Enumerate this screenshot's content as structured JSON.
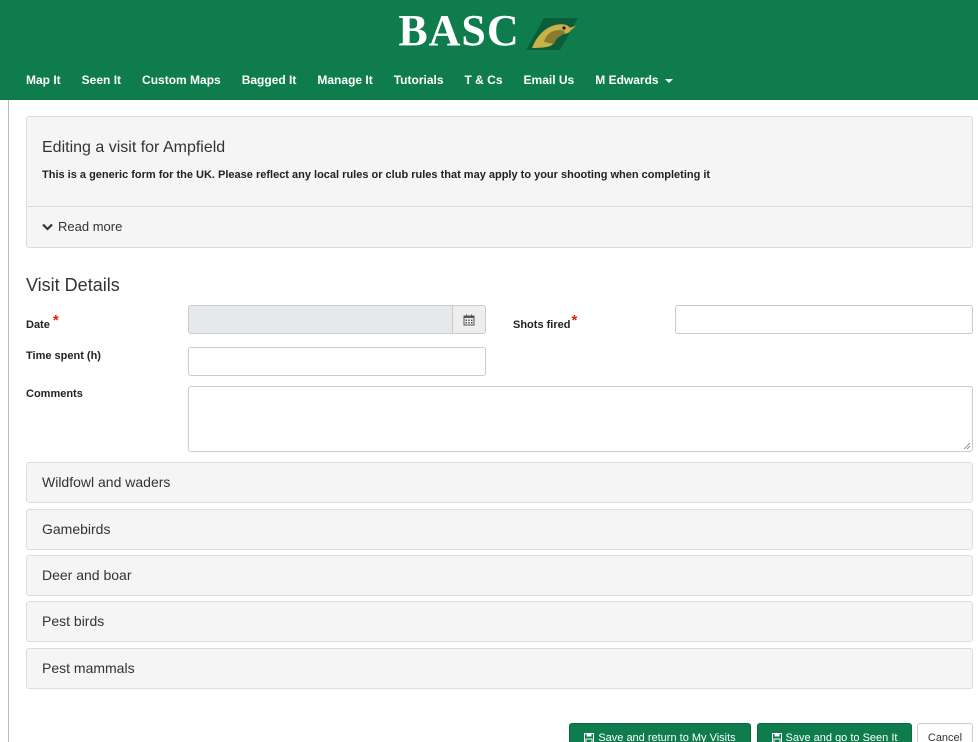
{
  "header": {
    "brand": "BASC",
    "brand_color": "#0f7c4d",
    "nav": [
      {
        "label": "Map It"
      },
      {
        "label": "Seen It"
      },
      {
        "label": "Custom Maps"
      },
      {
        "label": "Bagged It"
      },
      {
        "label": "Manage It"
      },
      {
        "label": "Tutorials"
      },
      {
        "label": "T & Cs"
      },
      {
        "label": "Email Us"
      },
      {
        "label": "M Edwards",
        "has_dropdown": true
      }
    ]
  },
  "info": {
    "title": "Editing a visit for Ampfield",
    "subtitle": "This is a generic form for the UK. Please reflect any local rules or club rules that may apply to your shooting when completing it",
    "read_more": "Read more",
    "read_more_icon": "chevron-down-icon"
  },
  "form": {
    "section_title": "Visit Details",
    "date_label": "Date",
    "date_value": "",
    "date_icon": "calendar-icon",
    "shots_label": "Shots fired",
    "shots_value": "",
    "time_label": "Time spent (h)",
    "time_value": "",
    "comments_label": "Comments",
    "comments_value": "",
    "required_marker": "*",
    "required_color": "#d9230f"
  },
  "categories": [
    {
      "label": "Wildfowl and waders"
    },
    {
      "label": "Gamebirds"
    },
    {
      "label": "Deer and boar"
    },
    {
      "label": "Pest birds"
    },
    {
      "label": "Pest mammals"
    }
  ],
  "actions": {
    "save_return": "Save and return to My Visits",
    "save_seen": "Save and go to Seen It",
    "cancel": "Cancel",
    "save_icon": "floppy-disk-icon"
  }
}
